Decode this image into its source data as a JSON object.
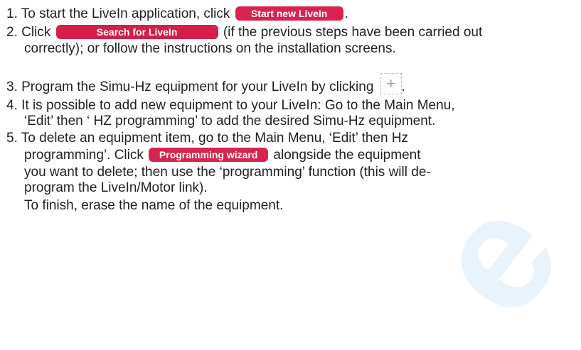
{
  "watermark": "e",
  "steps": [
    {
      "l1_a": "1. To start the LiveIn application, click ",
      "l1_btn": "Start new LiveIn",
      "l1_b": "."
    },
    {
      "l1_a": "2. Click ",
      "l1_btn": "Search for LiveIn",
      "l1_b": " (if the previous steps have been carried out",
      "l2": "correctly); or follow the instructions on the installation screens."
    },
    {
      "l1_a": "3. Program the Simu-Hz equipment for your LiveIn by clicking ",
      "icon_glyph": "+",
      "l1_b": "."
    },
    {
      "l1": "4. It is possible to add new equipment to your LiveIn: Go to the Main Menu,",
      "l2": "‘Edit’ then ‘ HZ programming’ to add the desired Simu-Hz equipment."
    },
    {
      "l1": "5. To delete an equipment item, go to the Main Menu, ‘Edit’ then Hz",
      "l2_a": "programming’. Click ",
      "l2_btn": "Programming wizard",
      "l2_b": " alongside the equipment",
      "l3": "you want to delete; then use the ‘programming’ function (this will de-",
      "l4": "program the LiveIn/Motor link).",
      "l5": "To finish, erase the name of the equipment."
    }
  ]
}
